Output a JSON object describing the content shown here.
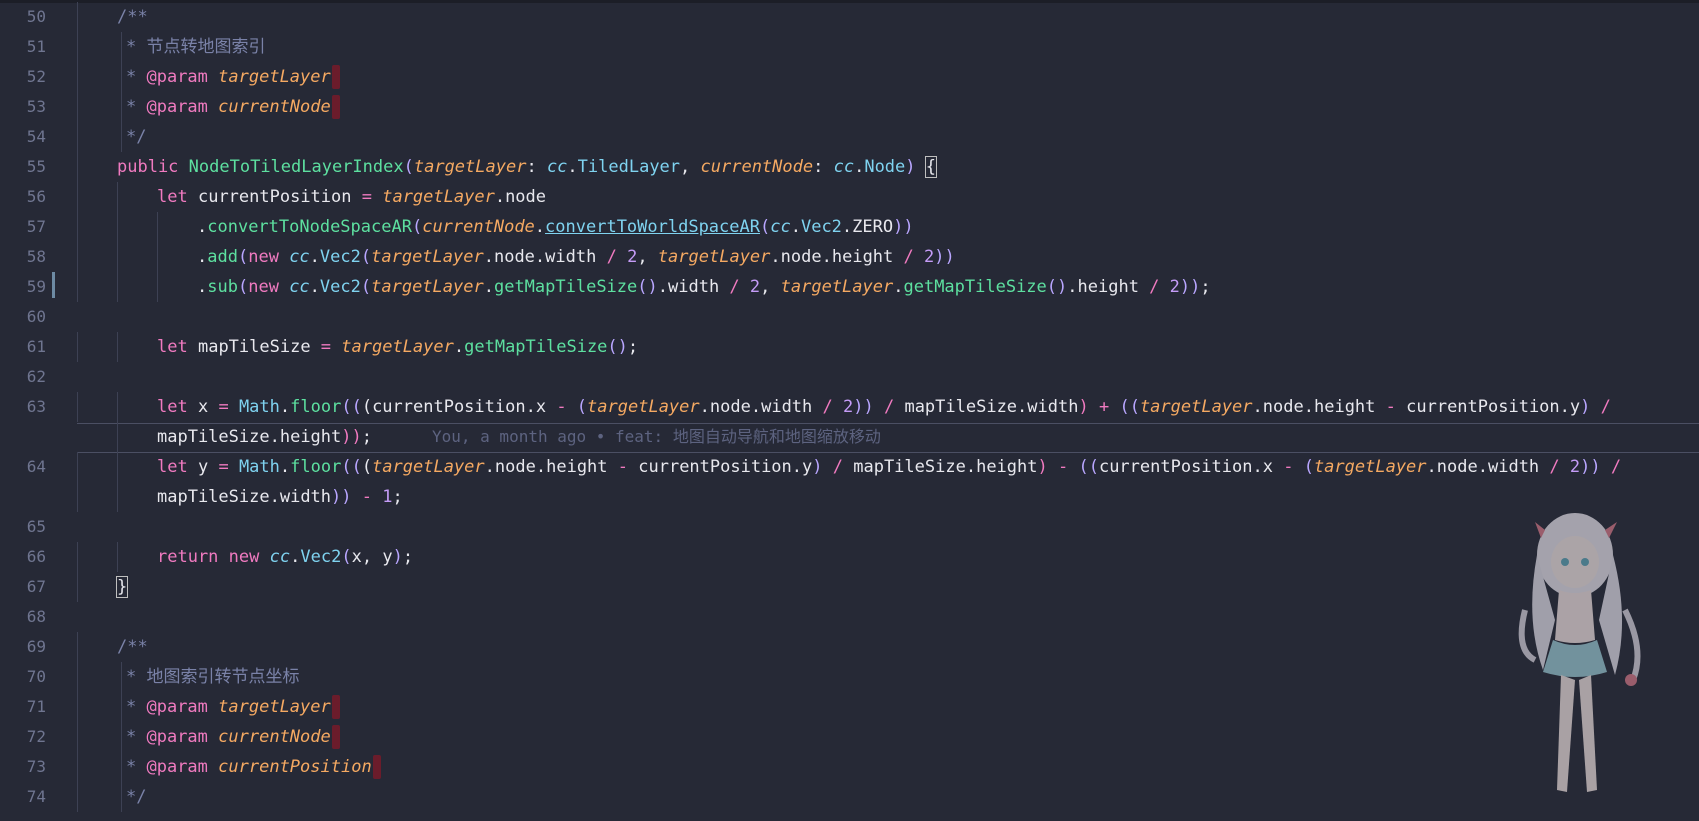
{
  "editor": {
    "blame_annotation": "You, a month ago • feat: 地图自动导航和地图缩放移动",
    "lines": [
      {
        "num": "50"
      },
      {
        "num": "51"
      },
      {
        "num": "52"
      },
      {
        "num": "53"
      },
      {
        "num": "54"
      },
      {
        "num": "55"
      },
      {
        "num": "56"
      },
      {
        "num": "57"
      },
      {
        "num": "58"
      },
      {
        "num": "59"
      },
      {
        "num": "60"
      },
      {
        "num": "61"
      },
      {
        "num": "62"
      },
      {
        "num": "63"
      },
      {
        "num": ""
      },
      {
        "num": "64"
      },
      {
        "num": ""
      },
      {
        "num": "65"
      },
      {
        "num": "66"
      },
      {
        "num": "67"
      },
      {
        "num": "68"
      },
      {
        "num": "69"
      },
      {
        "num": "70"
      },
      {
        "num": "71"
      },
      {
        "num": "72"
      },
      {
        "num": "73"
      },
      {
        "num": "74"
      }
    ],
    "code": {
      "l50": "/**",
      "l51": "* 节点转地图索引",
      "l52_tag": "@param",
      "l52_param": "targetLayer",
      "l53_param": "currentNode",
      "l54": "*/",
      "l55_public": "public",
      "l55_fn": "NodeToTiledLayerIndex",
      "l55_p1": "targetLayer",
      "l55_ns": "cc",
      "l55_t1": "TiledLayer",
      "l55_p2": "currentNode",
      "l55_t2": "Node",
      "l56_let": "let",
      "l56_var": "currentPosition",
      "l56_p": "targetLayer",
      "l56_prop": "node",
      "l57_fn": "convertToNodeSpaceAR",
      "l57_p": "currentNode",
      "l57_fn2": "convertToWorldSpaceAR",
      "l57_vec": "Vec2",
      "l57_zero": "ZERO",
      "l58_fn": "add",
      "l58_new": "new",
      "l58_width": "width",
      "l58_height": "height",
      "l58_num": "2",
      "l59_fn": "sub",
      "l59_get": "getMapTileSize",
      "l61_var": "mapTileSize",
      "l63_var": "x",
      "l63_math": "Math",
      "l63_floor": "floor",
      "l64_var": "y",
      "l64_one": "1",
      "l66_return": "return",
      "l70": "* 地图索引转节点坐标",
      "l73_param": "currentPosition"
    }
  }
}
